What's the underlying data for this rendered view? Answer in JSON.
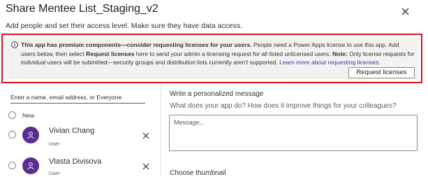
{
  "dialog": {
    "title": "Share Mentee List_Staging_v2",
    "subtitle": "Add people and set their access level. Make sure they have data access."
  },
  "icons": {
    "close": "close-icon",
    "info": "info-icon",
    "avatar": "person-icon",
    "remove": "remove-icon"
  },
  "colors": {
    "highlight_border": "#d9131c",
    "warning_background": "#f3f2f1",
    "avatar_background": "#5c2d91",
    "link": "#3a3aa6"
  },
  "warning": {
    "bold_intro": "This app has premium components—consider requesting licenses for your users.",
    "text_1": " People need a Power Apps license to use this app. Add users below, then select ",
    "bold_request": "Request licenses",
    "text_2": " here to send your admin a licensing request for all listed unlicensed users. ",
    "bold_note": "Note:",
    "text_3": " Only license requests for individual users will be submitted—security groups and distribution lists currently aren't supported. ",
    "link_text": "Learn more about requesting licenses.",
    "button_label": "Request licenses"
  },
  "people": {
    "search_placeholder": "Enter a name, email address, or Everyone",
    "new_label": "New",
    "users": [
      {
        "name": "Vivian Chang",
        "role": "User"
      },
      {
        "name": "Vlasta Divisova",
        "role": "User"
      }
    ]
  },
  "message": {
    "heading": "Write a personalized message",
    "subheading": "What does your app do? How does it improve things for your colleagues?",
    "placeholder": "Message..."
  },
  "thumbnail": {
    "heading": "Choose thumbnail"
  }
}
